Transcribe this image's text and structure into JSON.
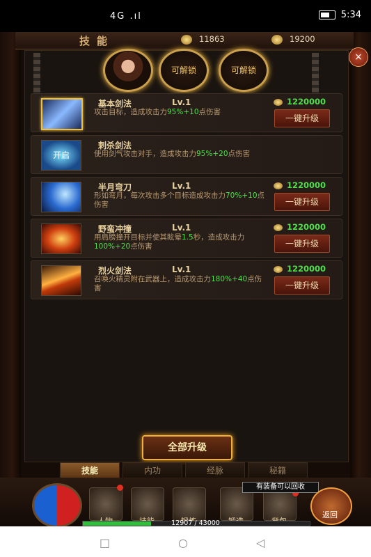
{
  "status_bar": {
    "signal": "4G .ıl",
    "time": "5:34"
  },
  "header": {
    "title": "技能",
    "resource1": "11863",
    "resource2": "19200",
    "close": "×"
  },
  "portrait": {
    "unlock_label_1": "可解锁",
    "unlock_label_2": "可解锁"
  },
  "skills": [
    {
      "name": "基本剑法",
      "level": "Lv.1",
      "desc_parts": [
        "攻击目标，造成攻击力",
        "95%+10",
        "点伤害"
      ],
      "cost": "1220000",
      "button": "一键升级",
      "selected": true
    },
    {
      "name": "刺杀剑法",
      "level": "",
      "desc_parts": [
        "使用剑气攻击对手，造成攻击力",
        "95%+20",
        "点伤害"
      ],
      "cost": "",
      "button": "",
      "icon_text": "开启",
      "selected": false
    },
    {
      "name": "半月弯刀",
      "level": "Lv.1",
      "desc_parts": [
        "形如弯月，每次攻击多个目标造成攻击力",
        "70%+10",
        "点伤害"
      ],
      "cost": "1220000",
      "button": "一键升级",
      "selected": false
    },
    {
      "name": "野蛮冲撞",
      "level": "Lv.1",
      "desc_parts": [
        "用肩膀撞开目标并使其眩晕",
        "1.5",
        "秒，造成攻击力",
        "100%+20",
        "点伤害"
      ],
      "cost": "1220000",
      "button": "一键升级",
      "selected": false
    },
    {
      "name": "烈火剑法",
      "level": "Lv.1",
      "desc_parts": [
        "召唤火精灵附在武器上，造成攻击力",
        "180%+40",
        "点伤害"
      ],
      "cost": "1220000",
      "button": "一键升级",
      "selected": false
    }
  ],
  "all_upgrade_button": "全部升级",
  "tabs": [
    "技能",
    "内功",
    "经脉",
    "秘籍"
  ],
  "active_tab": 0,
  "bottom_nav": [
    "人物",
    "技能",
    "锻炼",
    "锻造",
    "背包"
  ],
  "return_label": "返回",
  "tooltip": "有装备可以回收",
  "exp": {
    "text": "12907 / 43000",
    "fraction": 0.3
  },
  "android_nav": [
    "□",
    "○",
    "◁"
  ]
}
